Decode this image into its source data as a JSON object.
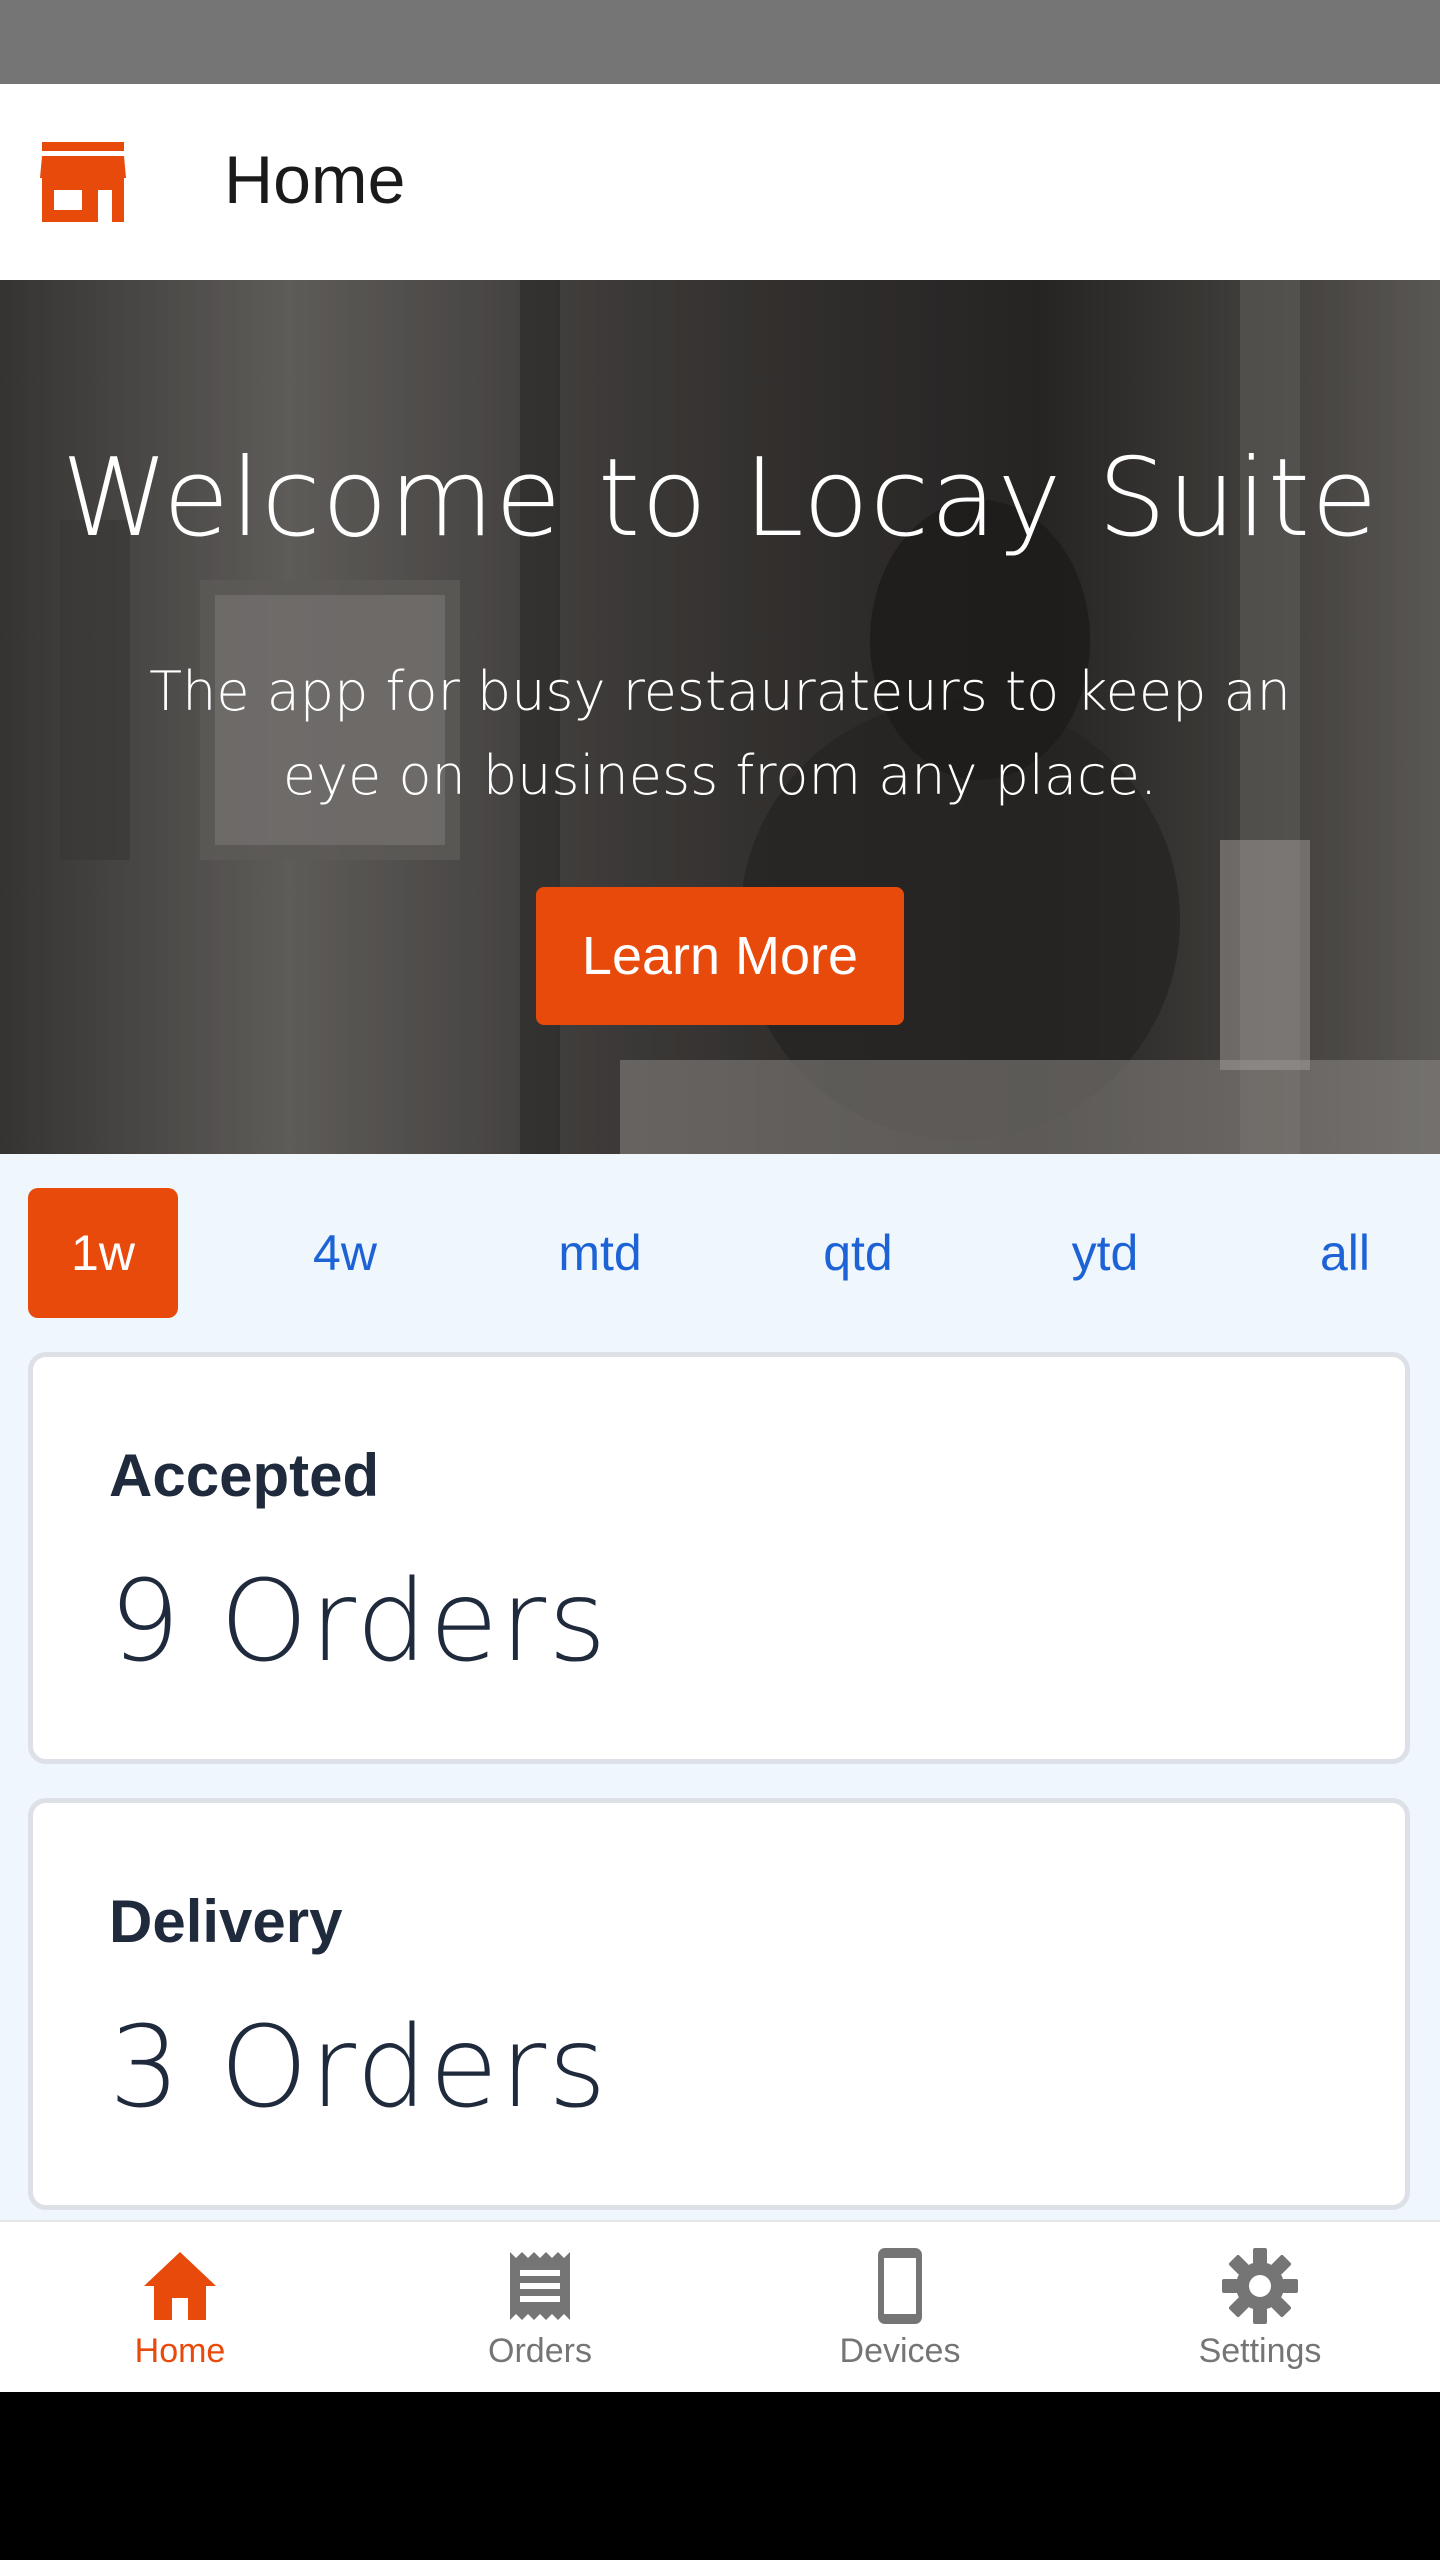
{
  "app_bar": {
    "title": "Home",
    "icon": "store-icon"
  },
  "hero": {
    "headline": "Welcome to Locay Suite",
    "subtitle": "The app for busy restaurateurs to keep an eye on business from any place.",
    "button_label": "Learn More"
  },
  "periods": {
    "items": [
      {
        "label": "1w",
        "active": true
      },
      {
        "label": "4w",
        "active": false
      },
      {
        "label": "mtd",
        "active": false
      },
      {
        "label": "qtd",
        "active": false
      },
      {
        "label": "ytd",
        "active": false
      },
      {
        "label": "all",
        "active": false
      }
    ]
  },
  "cards": [
    {
      "label": "Accepted",
      "value": "9 Orders"
    },
    {
      "label": "Delivery",
      "value": "3 Orders"
    }
  ],
  "bottom_nav": {
    "items": [
      {
        "label": "Home",
        "icon": "home-icon",
        "active": true
      },
      {
        "label": "Orders",
        "icon": "receipt-icon",
        "active": false
      },
      {
        "label": "Devices",
        "icon": "phone-icon",
        "active": false
      },
      {
        "label": "Settings",
        "icon": "gear-icon",
        "active": false
      }
    ]
  },
  "colors": {
    "accent": "#e84a0c",
    "link": "#1e63d6",
    "content_bg": "#eff6fc",
    "nav_inactive": "#757575"
  }
}
